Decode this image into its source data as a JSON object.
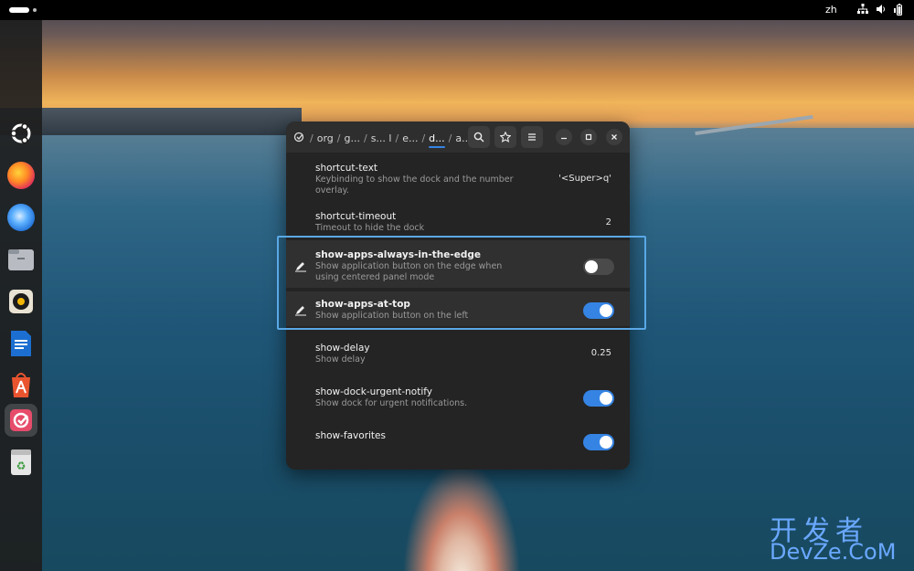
{
  "topbar": {
    "language": "zh",
    "tray_icons": [
      "network-icon",
      "volume-icon",
      "battery-icon"
    ]
  },
  "dock": {
    "apps": [
      {
        "name": "ubuntu-logo-icon"
      },
      {
        "name": "firefox-icon"
      },
      {
        "name": "thunderbird-icon"
      },
      {
        "name": "files-icon"
      },
      {
        "name": "rhythmbox-icon"
      },
      {
        "name": "writer-icon"
      },
      {
        "name": "app-center-icon"
      },
      {
        "name": "dconf-editor-icon",
        "active": true
      },
      {
        "name": "trash-icon"
      }
    ]
  },
  "window": {
    "breadcrumbs": [
      "org",
      "g...",
      "s... l",
      "e...",
      "d...",
      "a..."
    ],
    "breadcrumb_current_index": 4,
    "search_label": "search",
    "bookmarks_label": "bookmarks",
    "menu_label": "menu",
    "rows": [
      {
        "key": "shortcut-text",
        "desc": "Keybinding to show the dock and the number overlay.",
        "value": "'<Super>q'",
        "kind": "text"
      },
      {
        "key": "shortcut-timeout",
        "desc": "Timeout to hide the dock",
        "value": "2",
        "kind": "text"
      },
      {
        "key": "show-apps-always-in-the-edge",
        "desc": "Show application button on the edge when using centered panel mode",
        "value": "off",
        "kind": "toggle",
        "modified": true
      },
      {
        "key": "show-apps-at-top",
        "desc": "Show application button on the left",
        "value": "on",
        "kind": "toggle",
        "modified": true
      },
      {
        "key": "show-delay",
        "desc": "Show delay",
        "value": "0.25",
        "kind": "text"
      },
      {
        "key": "show-dock-urgent-notify",
        "desc": "Show dock for urgent notifications.",
        "value": "on",
        "kind": "toggle"
      },
      {
        "key": "show-favorites",
        "desc": "",
        "value": "on",
        "kind": "toggle"
      }
    ]
  },
  "colors": {
    "accent": "#3584e4",
    "highlight_box": "#5aa8e6",
    "window_bg": "#242424"
  },
  "watermark": {
    "cn": "开发者",
    "en": "DevZe.CoM"
  }
}
